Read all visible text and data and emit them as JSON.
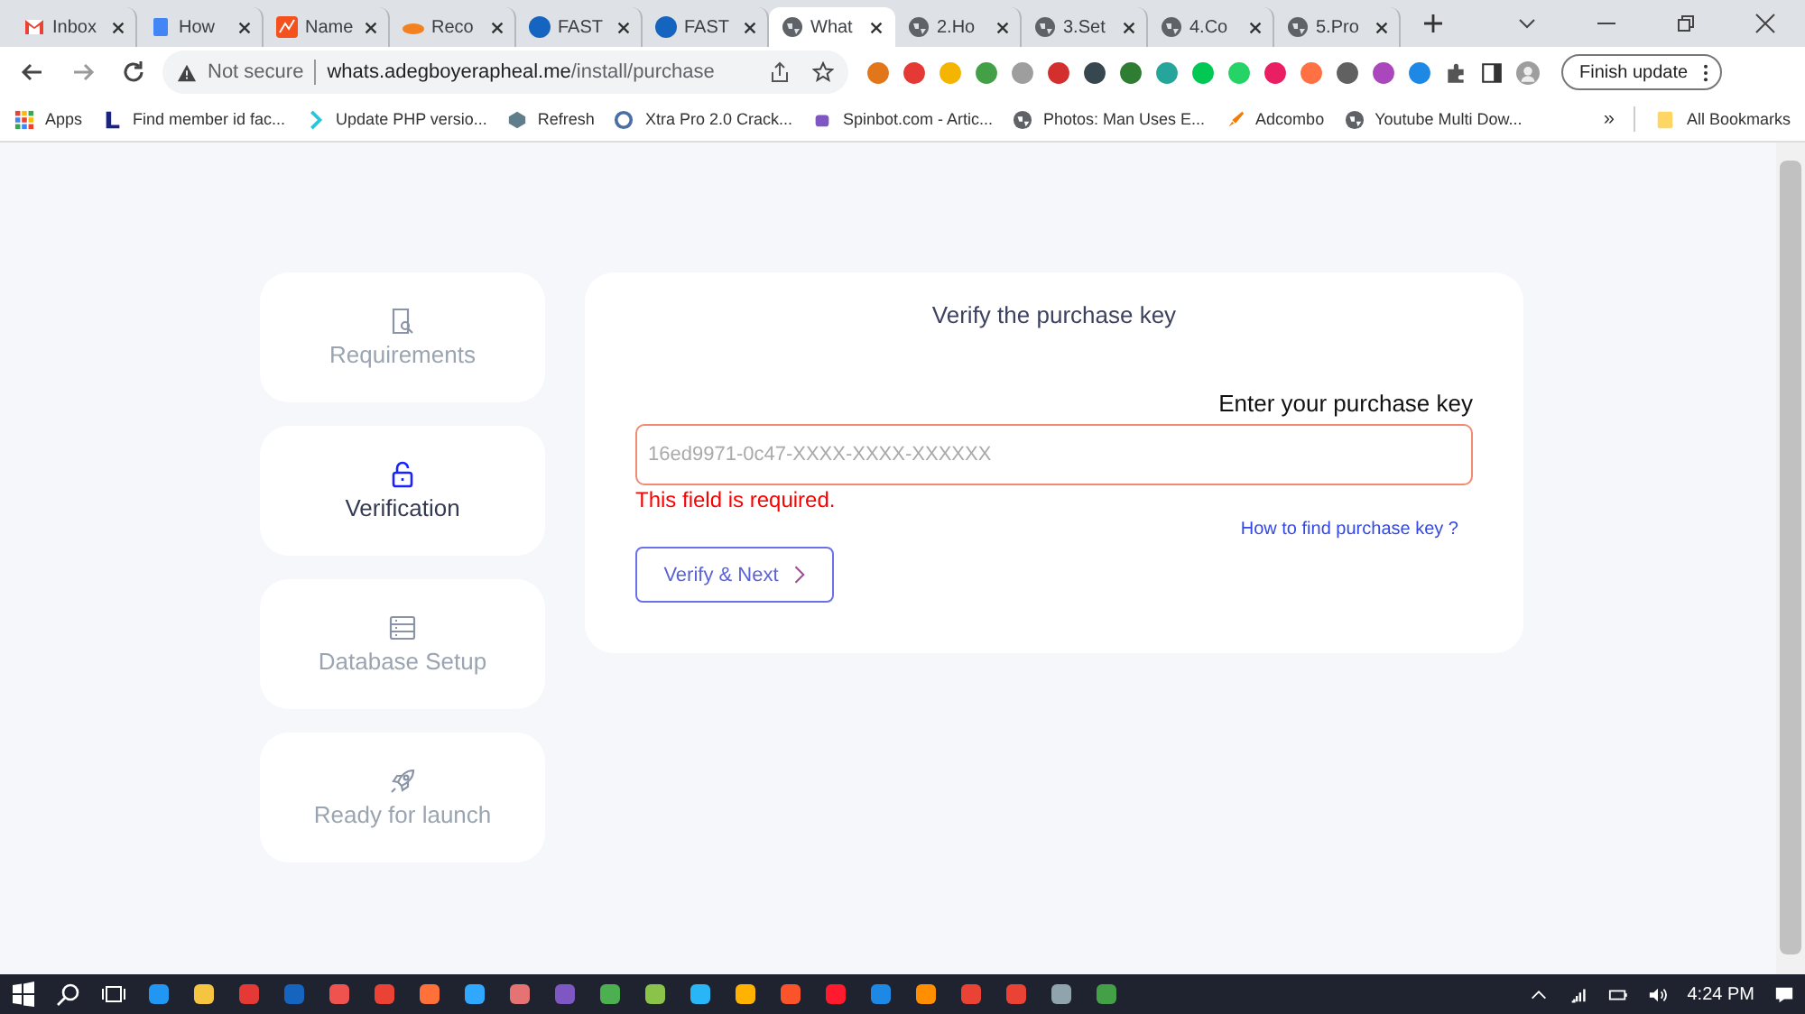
{
  "browser": {
    "tabs": [
      {
        "label": "Inbox",
        "selected": false
      },
      {
        "label": "How",
        "selected": false
      },
      {
        "label": "Name",
        "selected": false
      },
      {
        "label": "Reco",
        "selected": false
      },
      {
        "label": "FAST",
        "selected": false
      },
      {
        "label": "FAST",
        "selected": false
      },
      {
        "label": "What",
        "selected": true
      },
      {
        "label": "2.Ho",
        "selected": false
      },
      {
        "label": "3.Set",
        "selected": false
      },
      {
        "label": "4.Co",
        "selected": false
      },
      {
        "label": "5.Pro",
        "selected": false
      }
    ],
    "security": "Not secure",
    "url_host": "whats.adegboyerapheal.me",
    "url_path": "/install/purchase",
    "update_button": "Finish update",
    "bookmarks": [
      "Apps",
      "Find member id fac...",
      "Update PHP versio...",
      "Refresh",
      "Xtra Pro 2.0 Crack...",
      "Spinbot.com - Artic...",
      "Photos: Man Uses E...",
      "Adcombo",
      "Youtube Multi Dow..."
    ],
    "more_bookmarks": "»",
    "all_bookmarks": "All Bookmarks"
  },
  "steps": [
    {
      "label": "Requirements",
      "kind": "document",
      "selected": false
    },
    {
      "label": "Verification",
      "kind": "lock",
      "selected": true
    },
    {
      "label": "Database Setup",
      "kind": "database",
      "selected": false
    },
    {
      "label": "Ready for launch",
      "kind": "rocket",
      "selected": false
    }
  ],
  "form": {
    "title": "Verify the purchase key",
    "label": "Enter your purchase key",
    "placeholder": "16ed9971-0c47-XXXX-XXXX-XXXXXX",
    "invalid": true,
    "error": "This field is required.",
    "help_link": "How to find purchase key ?",
    "submit": "Verify & Next"
  },
  "taskbar": {
    "time": "4:24 PM"
  }
}
